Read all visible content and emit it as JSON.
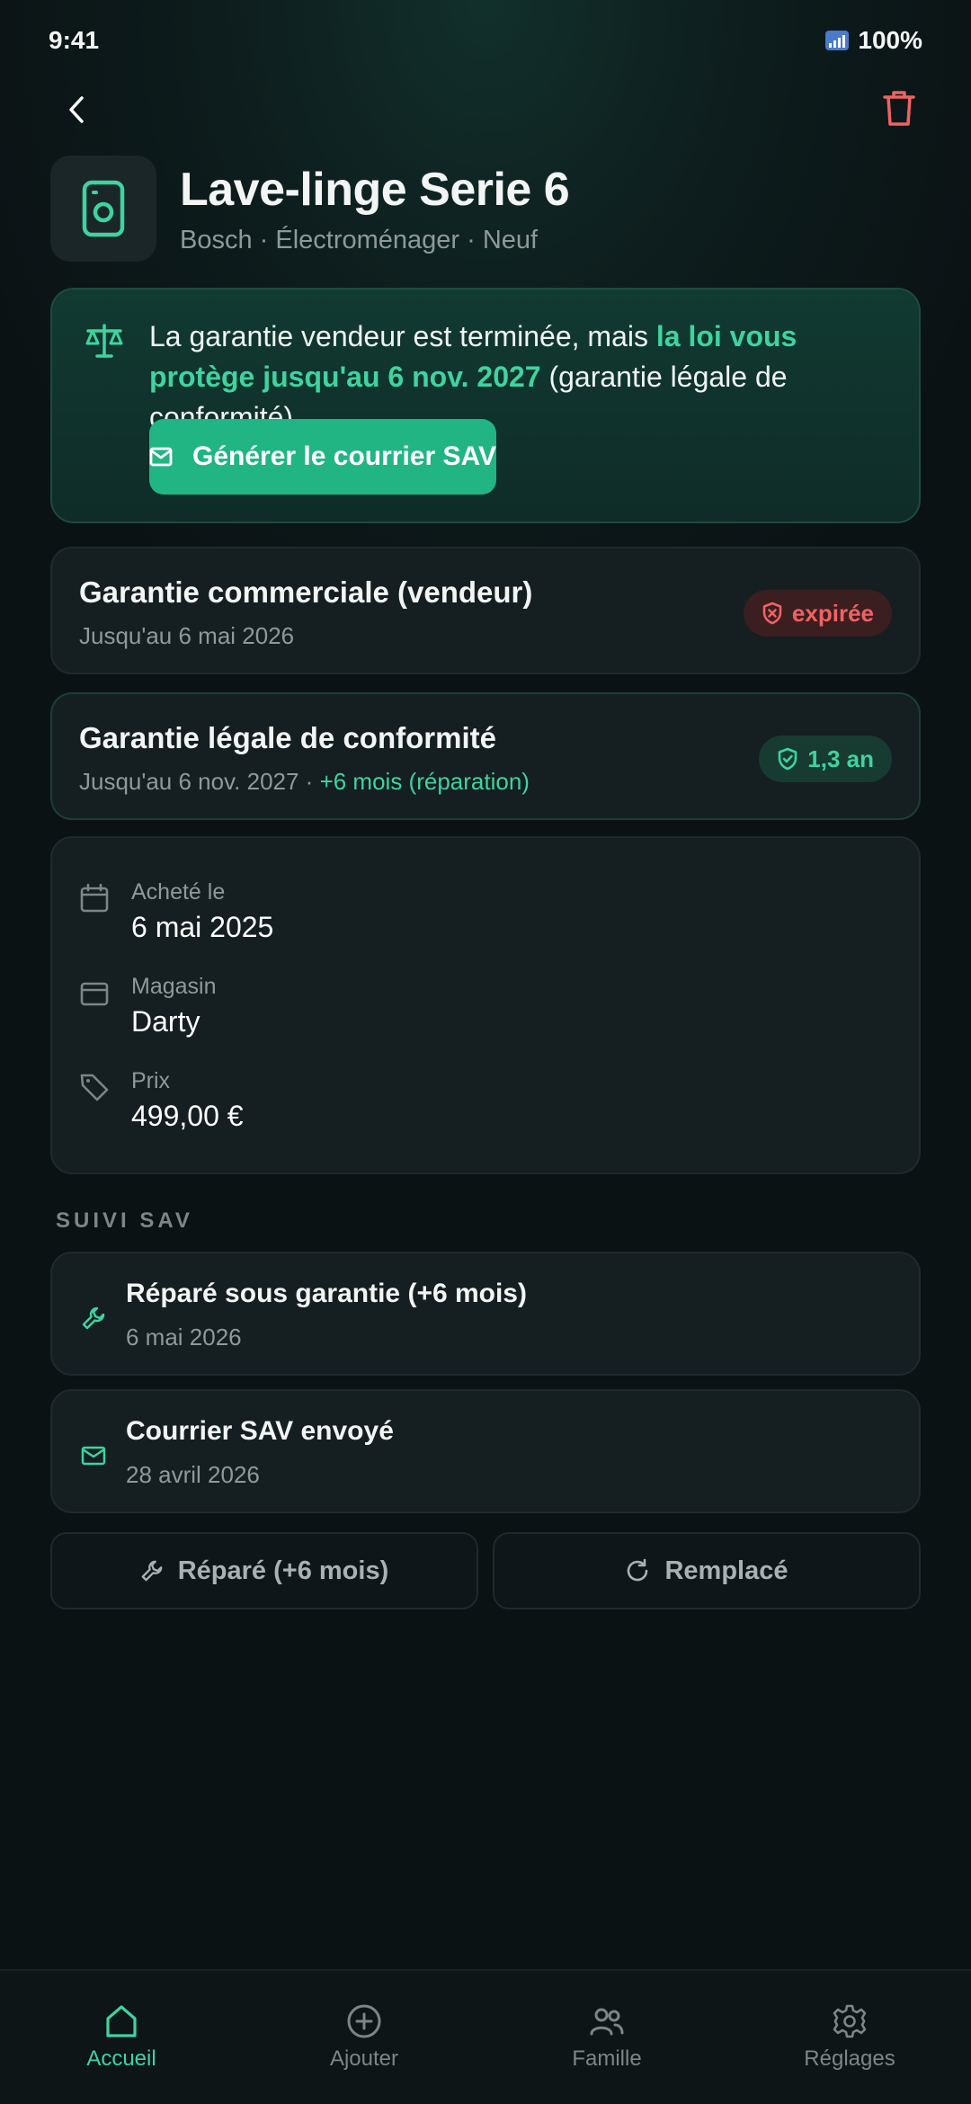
{
  "status_bar": {
    "time": "9:41",
    "battery": "100%"
  },
  "product": {
    "title": "Lave-linge Serie 6",
    "subtitle": "Bosch · Électroménager · Neuf"
  },
  "alert": {
    "text_before": "La garantie vendeur est terminée, mais ",
    "text_highlight": "la loi vous protège jusqu'au 6 nov. 2027",
    "text_after": " (garantie légale de conformité).",
    "button_label": "Générer le courrier SAV"
  },
  "warranty_commercial": {
    "title": "Garantie commerciale (vendeur)",
    "subtitle": "Jusqu'au 6 mai 2026",
    "badge": "expirée"
  },
  "warranty_legal": {
    "title": "Garantie légale de conformité",
    "subtitle": "Jusqu'au 6 nov. 2027 · ",
    "subtitle_extra": "+6 mois (réparation)",
    "badge": "1,3 an"
  },
  "details": {
    "purchase_label": "Acheté le",
    "purchase_value": "6 mai 2025",
    "store_label": "Magasin",
    "store_value": "Darty",
    "price_label": "Prix",
    "price_value": "499,00 €"
  },
  "sav": {
    "section_title": "SUIVI SAV",
    "items": [
      {
        "title": "Réparé sous garantie (+6 mois)",
        "date": "6 mai 2026",
        "icon": "wrench-icon"
      },
      {
        "title": "Courrier SAV envoyé",
        "date": "28 avril 2026",
        "icon": "mail-icon"
      }
    ],
    "repaired_button": "Réparé (+6 mois)",
    "replaced_button": "Remplacé"
  },
  "nav": {
    "items": [
      {
        "label": "Accueil",
        "icon": "home-icon",
        "active": true
      },
      {
        "label": "Ajouter",
        "icon": "plus-circle-icon",
        "active": false
      },
      {
        "label": "Famille",
        "icon": "users-icon",
        "active": false
      },
      {
        "label": "Réglages",
        "icon": "gear-icon",
        "active": false
      }
    ]
  },
  "colors": {
    "accent": "#3fd39f",
    "button": "#22b584",
    "danger": "#f06262",
    "background": "#0b1214"
  }
}
